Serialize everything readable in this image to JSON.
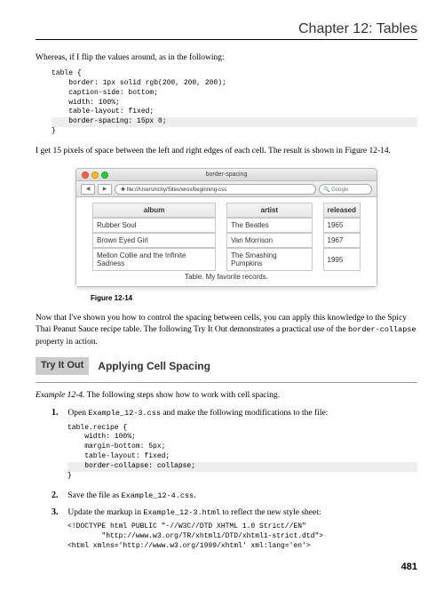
{
  "chapter": "Chapter 12: Tables",
  "para1": "Whereas, if I flip the values around, as in the following:",
  "code1": {
    "l1": "table {",
    "l2": "    border: 1px solid rgb(200, 200, 200);",
    "l3": "    caption-side: bottom;",
    "l4": "    width: 100%;",
    "l5": "    table-layout: fixed;",
    "l6": "    border-spacing: 15px 0;",
    "l7": "}"
  },
  "para2": "I get 15 pixels of space between the left and right edges of each cell. The result is shown in Figure 12-14.",
  "browser": {
    "title": "border-spacing",
    "url": "file:///Users/richy/Sites/wrox/beginning-css",
    "search_placeholder": "Google",
    "dot_colors": {
      "red": "#ff5f57",
      "yellow": "#febc2e",
      "green": "#28c840"
    }
  },
  "table": {
    "headers": [
      "album",
      "artist",
      "released"
    ],
    "rows": [
      [
        "Rubber Soul",
        "The Beatles",
        "1965"
      ],
      [
        "Brown Eyed Girl",
        "Van Morrison",
        "1967"
      ],
      [
        "Mellon Collie and the Infinite Sadness",
        "The Smashing Pumpkins",
        "1995"
      ]
    ],
    "caption": "Table. My favorite records."
  },
  "figure_label": "Figure 12-14",
  "para3a": "Now that I've shown you how to control the spacing between cells, you can apply this knowledge to the Spicy Thai Peanut Sauce recipe table. The following Try It Out demonstrates a practical use of the ",
  "para3code": "border-collapse",
  "para3b": " property in action.",
  "tio_badge": "Try It Out",
  "tio_title": "Applying Cell Spacing",
  "example_line_before": "Example 12-4.",
  "example_line_after": " The following steps show how to work with cell spacing.",
  "steps": {
    "s1a": "Open ",
    "s1code": "Example_12-3.css",
    "s1b": " and make the following modifications to the file:",
    "s2a": "Save the file as ",
    "s2code": "Example_12-4.css",
    "s2b": ".",
    "s3a": "Update the markup in ",
    "s3code": "Example_12-3.html",
    "s3b": " to reflect the new style sheet:"
  },
  "code2": {
    "l1": "table.recipe {",
    "l2": "    width: 100%;",
    "l3": "    margin-bottom: 5px;",
    "l4": "    table-layout: fixed;",
    "l5": "    border-collapse: collapse;",
    "l6": "}"
  },
  "code3": {
    "l1": "<!DOCTYPE html PUBLIC \"-//W3C//DTD XHTML 1.0 Strict//EN\"",
    "l2": "        \"http://www.w3.org/TR/xhtml1/DTD/xhtml1-strict.dtd\">",
    "l3": "<html xmlns='http://www.w3.org/1999/xhtml' xml:lang='en'>"
  },
  "page_number": "481"
}
